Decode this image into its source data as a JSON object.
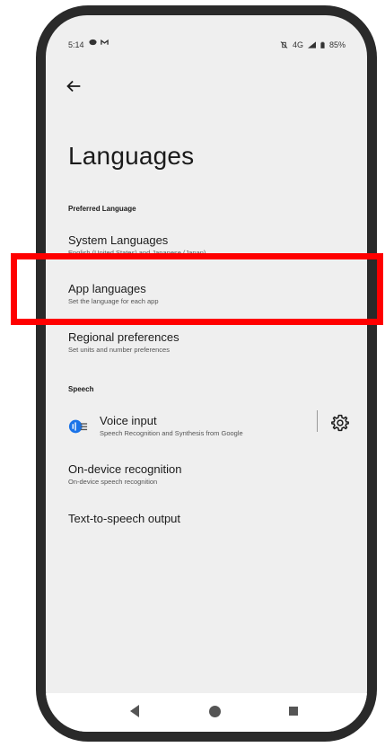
{
  "status_bar": {
    "time": "5:14",
    "network": "4G",
    "battery": "85%"
  },
  "page": {
    "title": "Languages"
  },
  "sections": {
    "preferred": {
      "header": "Preferred Language",
      "items": [
        {
          "title": "System Languages",
          "summary": "English (United States) and Japanese (Japan)"
        },
        {
          "title": "App languages",
          "summary": "Set the language for each app"
        },
        {
          "title": "Regional preferences",
          "summary": "Set units and number preferences"
        }
      ]
    },
    "speech": {
      "header": "Speech",
      "voice_input": {
        "title": "Voice input",
        "summary": "Speech Recognition and Synthesis from Google"
      },
      "on_device": {
        "title": "On-device recognition",
        "summary": "On-device speech recognition"
      },
      "tts": {
        "title": "Text-to-speech output"
      }
    }
  },
  "colors": {
    "highlight": "#ff0000",
    "accent": "#1a73e8",
    "screen_bg": "#efefef"
  }
}
